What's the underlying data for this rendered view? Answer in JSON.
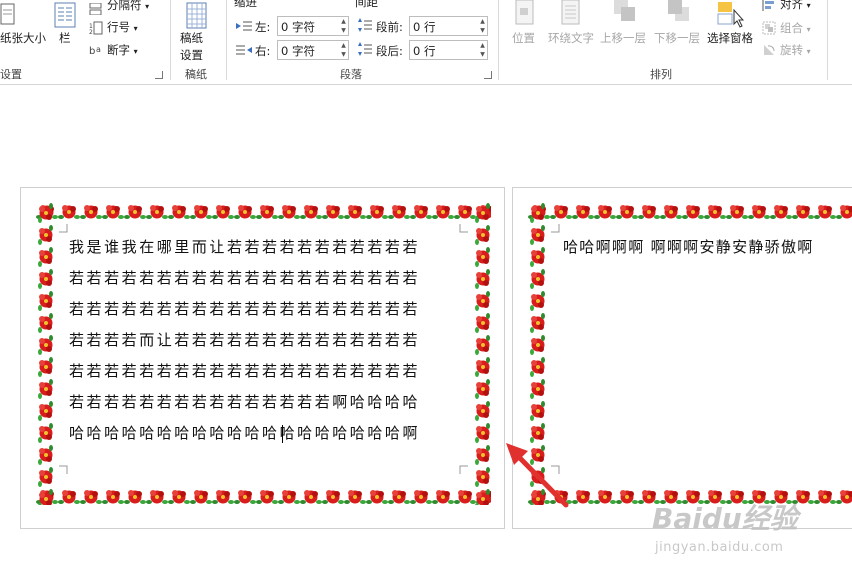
{
  "ribbon": {
    "page_setup": {
      "size_label": "纸张大小",
      "columns_label": "栏",
      "breaks_label": "分隔符",
      "line_numbers_label": "行号",
      "hyphenation_label": "断字",
      "group_label": "设置"
    },
    "manuscript": {
      "button_label_1": "稿纸",
      "button_label_2": "设置",
      "group_label": "稿纸"
    },
    "paragraph": {
      "indent_header": "缩进",
      "spacing_header": "间距",
      "left_label": "左:",
      "right_label": "右:",
      "before_label": "段前:",
      "after_label": "段后:",
      "left_value": "0 字符",
      "right_value": "0 字符",
      "before_value": "0 行",
      "after_value": "0 行",
      "group_label": "段落"
    },
    "arrange": {
      "position_label": "位置",
      "wrap_text_label": "环绕文字",
      "bring_forward_label": "上移一层",
      "send_backward_label": "下移一层",
      "selection_pane_label": "选择窗格",
      "align_label": "对齐",
      "group_objects_label": "组合",
      "rotate_label": "旋转",
      "group_label": "排列"
    }
  },
  "document": {
    "page1_lines": [
      "我是谁我在哪里而让若若若若若若若若若若若",
      "若若若若若若若若若若若若若若若若若若若若",
      "若若若若若若若若若若若若若若若若若若若若",
      "若若若若而让若若若若若若若若若若若若若若",
      "若若若若若若若若若若若若若若若若若若若若",
      "若若若若若若若若若若若若若若若啊哈哈哈哈",
      "哈哈哈哈哈哈哈哈哈哈哈哈哈哈哈哈哈哈哈啊"
    ],
    "page2_lines": [
      "哈哈啊啊啊  啊啊啊安静安静骄傲啊"
    ]
  },
  "annotation": {
    "arrow_color": "#e0312e"
  },
  "watermark": {
    "brand": "Baidu经验",
    "url": "jingyan.baidu.com"
  },
  "colors": {
    "border_flower_red": "#d91c1c",
    "border_leaf_green": "#2e8b2e",
    "ribbon_background": "#ffffff",
    "disabled_text": "#a7a7a7"
  }
}
